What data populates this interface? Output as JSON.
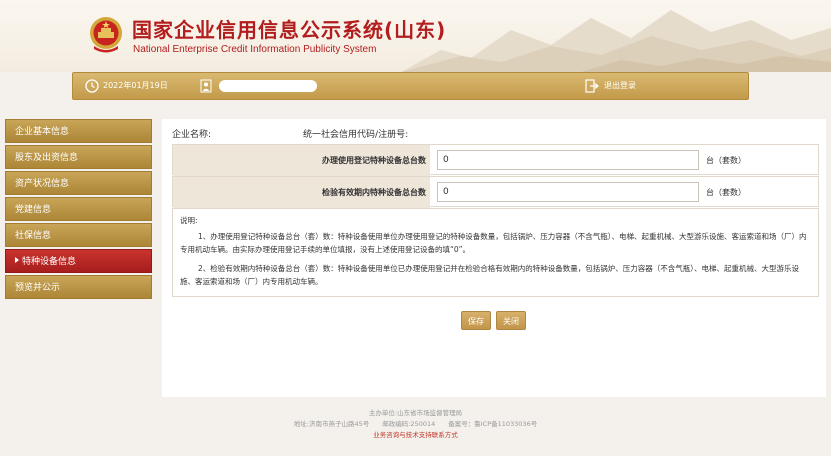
{
  "header": {
    "title_cn": "国家企业信用信息公示系统(山东)",
    "title_en": "National Enterprise Credit Information Publicity System"
  },
  "topbar": {
    "date": "2022年01月19日",
    "logout_label": "退出登录"
  },
  "sidebar": {
    "items": [
      {
        "label": "企业基本信息"
      },
      {
        "label": "股东及出资信息"
      },
      {
        "label": "资产状况信息"
      },
      {
        "label": "党建信息"
      },
      {
        "label": "社保信息"
      },
      {
        "label": "特种设备信息"
      },
      {
        "label": "预览并公示"
      }
    ]
  },
  "main": {
    "company_name_label": "企业名称:",
    "credit_code_label": "统一社会信用代码/注册号:",
    "rows": [
      {
        "label": "办理使用登记特种设备总台数",
        "value": "0",
        "unit": "台（套数）"
      },
      {
        "label": "检验有效期内特种设备总台数",
        "value": "0",
        "unit": "台（套数）"
      }
    ],
    "notes": {
      "heading": "说明:",
      "para1": "1、办理使用登记特种设备总台（套）数：特种设备使用单位办理使用登记的特种设备数量，包括锅炉、压力容器（不含气瓶）、电梯、起重机械、大型游乐设施、客运索道和场（厂）内专用机动车辆。由实际办理使用登记手续的单位填报，没有上述使用登记设备的填“0”。",
      "para2": "2、检验有效期内特种设备总台（套）数：特种设备使用单位已办理使用登记并在检验合格有效期内的特种设备数量，包括锅炉、压力容器（不含气瓶）、电梯、起重机械、大型游乐设施、客运索道和场（厂）内专用机动车辆。"
    },
    "save_label": "保存",
    "close_label": "关闭"
  },
  "footer": {
    "line1": "主办单位:山东省市场监督管理局",
    "line2": "地址:济南市燕子山路45号　　邮政编码:250014　　备案号：鲁ICP备11033036号",
    "line3": "业务咨询与技术支持联系方式"
  },
  "colors": {
    "brand_red": "#b21d1d",
    "gold": "#c39a4a",
    "active_red": "#a71e1e"
  }
}
